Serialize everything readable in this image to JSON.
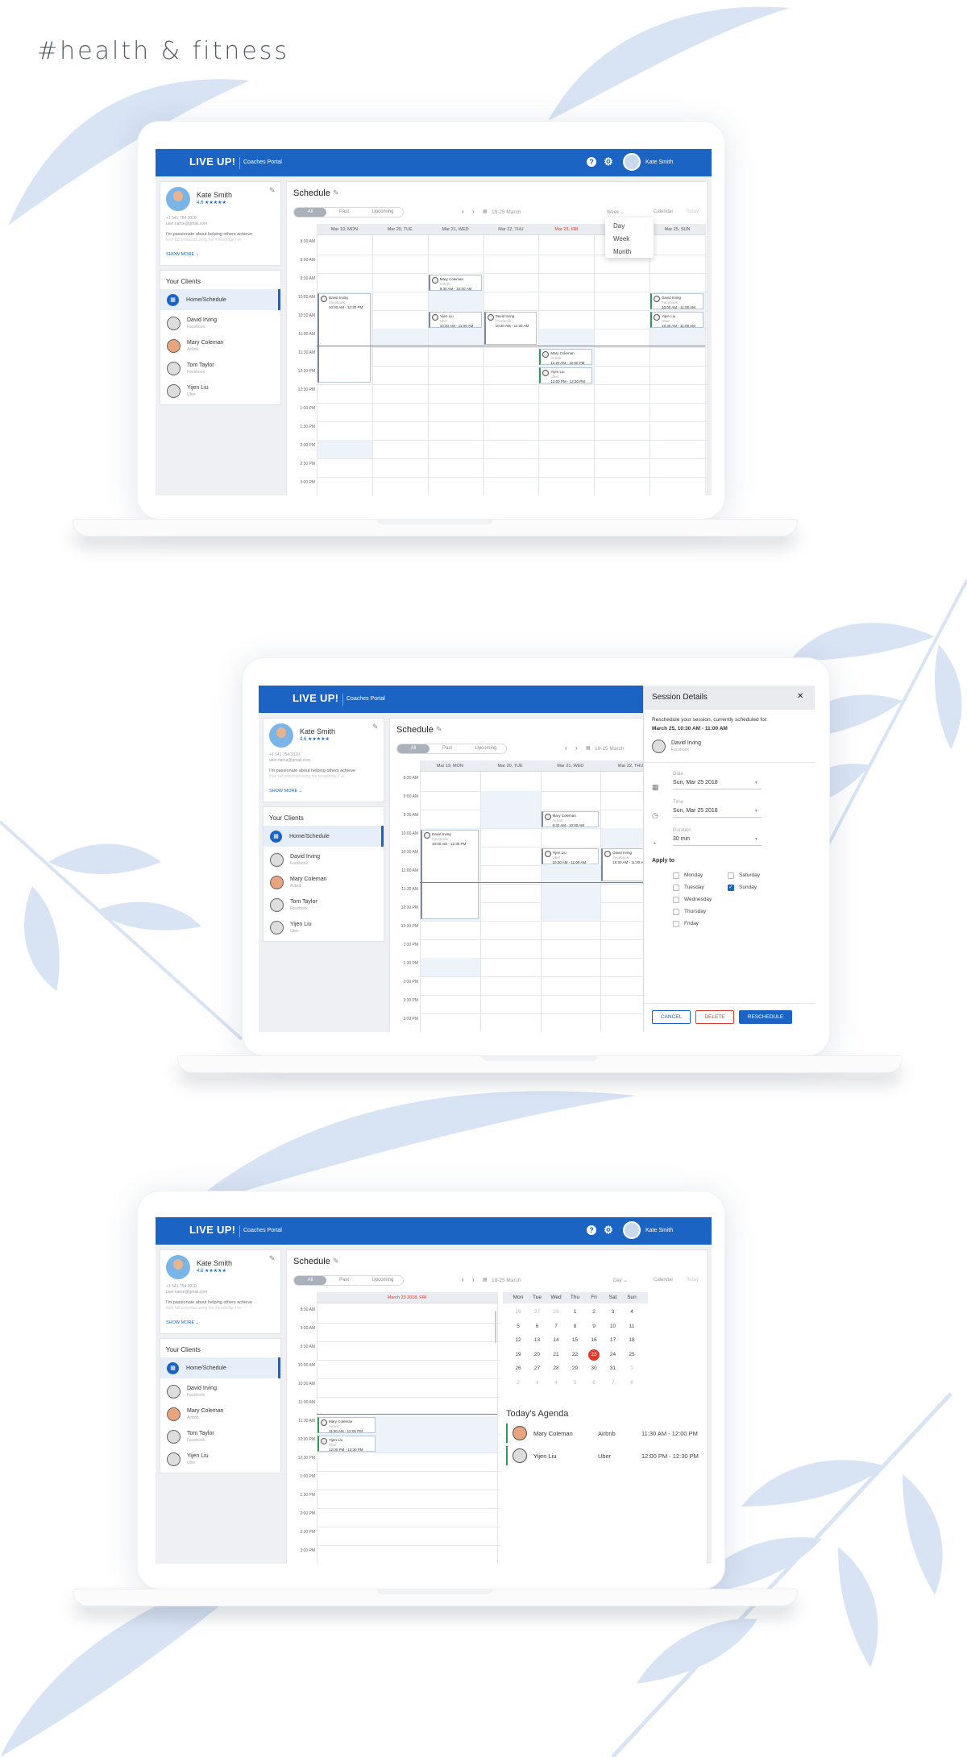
{
  "hashtag": "#health & fitness",
  "app": {
    "brand": "LIVE UP!",
    "portal": "Coaches Portal",
    "help_icon": "?",
    "settings_icon": "⚙",
    "user_name": "Kate Smith"
  },
  "profile": {
    "name": "Kate Smith",
    "rating": "4.6 ★★★★★",
    "phone": "+1 541 754 3010",
    "email": "user.name@gmail.com",
    "bio": "I'm passionate about helping others achieve",
    "bio_faded": "their full potential using the knowledge I've",
    "show_more": "SHOW MORE ⌄"
  },
  "clients": {
    "title": "Your Clients",
    "home": "Home/Schedule",
    "items": [
      {
        "name": "David Irving",
        "company": "Facebook"
      },
      {
        "name": "Mary Coleman",
        "company": "Airbnb"
      },
      {
        "name": "Tom Taylor",
        "company": "Facebook"
      },
      {
        "name": "Yijen Liu",
        "company": "Uber"
      }
    ]
  },
  "schedule": {
    "title": "Schedule",
    "filters": [
      "All",
      "Past",
      "Upcoming"
    ],
    "date_range": "19-25 March",
    "view_week": "Week ⌄",
    "view_day": "Day ⌄",
    "calendar": "Calendar",
    "today": "Today",
    "views": [
      "Day",
      "Week",
      "Month"
    ],
    "days": [
      "Mar 19, MON",
      "Mar 20, TUE",
      "Mar 21, WED",
      "Mar 22, THU",
      "Mar 23, FRI",
      "Mar 24, SAT",
      "Mar 25, SUN"
    ],
    "day_view_header": "March 23 2018, FRI",
    "times": [
      "8:30 AM",
      "9:00 AM",
      "9:30 AM",
      "10:00 AM",
      "10:30 AM",
      "11:00 AM",
      "11:30 AM",
      "12:30 PM",
      "12:30 PM",
      "1:00 PM",
      "1:30 PM",
      "2:00 PM",
      "2:30 PM",
      "3:00 PM",
      "3:30 PM"
    ],
    "events": {
      "david_mon": {
        "name": "David Irving",
        "company": "Facebook",
        "time": "10:00 AM - 12:30 PM"
      },
      "mary_wed": {
        "name": "Mary Coleman",
        "company": "Airbnb",
        "time": "9:30 AM - 10:00 AM"
      },
      "yijen_wed": {
        "name": "Yijen Liu",
        "company": "Uber",
        "time": "10:30 AM - 11:00 AM"
      },
      "david_thu": {
        "name": "David Irving",
        "company": "Facebook",
        "time": "10:30 AM - 11:30 AM"
      },
      "mary_fri": {
        "name": "Mary Coleman",
        "company": "Airbnb",
        "time": "11:30 AM - 12:00 PM"
      },
      "yijen_fri": {
        "name": "Yijen Liu",
        "company": "Uber",
        "time": "12:00 PM - 12:30 PM"
      },
      "david_sun": {
        "name": "David Irving",
        "company": "Facebook",
        "time": "10:00 AM - 11:00 AM"
      },
      "yijen_sun": {
        "name": "Yijen Liu",
        "company": "Uber",
        "time": "10:30 AM - 11:00 AM"
      }
    }
  },
  "session": {
    "title": "Session Details",
    "close": "✕",
    "intro": "Reschedule your session, currently scheduled for:",
    "current": "March 25, 10:30 AM - 11:00 AM",
    "client_name": "David Irving",
    "client_company": "Facebook",
    "date_label": "Date",
    "date_value": "Sun, Mar 25 2018",
    "time_label": "Time",
    "time_value": "Sun, Mar 25 2018",
    "duration_label": "Duration",
    "duration_value": "30 min",
    "apply_to": "Apply to",
    "weekdays": [
      {
        "label": "Monday",
        "checked": false
      },
      {
        "label": "Tuesday",
        "checked": false
      },
      {
        "label": "Wednesday",
        "checked": false
      },
      {
        "label": "Thursday",
        "checked": false
      },
      {
        "label": "Friday",
        "checked": false
      },
      {
        "label": "Saturday",
        "checked": false
      },
      {
        "label": "Sunday",
        "checked": true
      }
    ],
    "cancel": "CANCEL",
    "delete": "DELETE",
    "reschedule": "RESCHEDULE"
  },
  "minical": {
    "weekdays": [
      "Mon",
      "Tue",
      "Wed",
      "Thu",
      "Fri",
      "Sat",
      "Sun"
    ],
    "weeks": [
      [
        "26",
        "27",
        "28",
        "1",
        "2",
        "3",
        "4"
      ],
      [
        "5",
        "6",
        "7",
        "8",
        "9",
        "10",
        "11"
      ],
      [
        "12",
        "13",
        "14",
        "15",
        "16",
        "17",
        "18"
      ],
      [
        "19",
        "20",
        "21",
        "22",
        "23",
        "24",
        "25"
      ],
      [
        "26",
        "27",
        "28",
        "29",
        "30",
        "31",
        "1"
      ],
      [
        "2",
        "3",
        "4",
        "5",
        "6",
        "7",
        "8"
      ]
    ],
    "selected": "23"
  },
  "agenda": {
    "title": "Today's Agenda",
    "items": [
      {
        "name": "Mary Coleman",
        "company": "Airbnb",
        "time": "11:30 AM - 12:00 PM"
      },
      {
        "name": "Yijen Liu",
        "company": "Uber",
        "time": "12:00 PM - 12:30 PM"
      }
    ]
  },
  "colors": {
    "brand": "#1b64c3",
    "today": "#e5372a",
    "accent_green": "#2f9a58"
  }
}
